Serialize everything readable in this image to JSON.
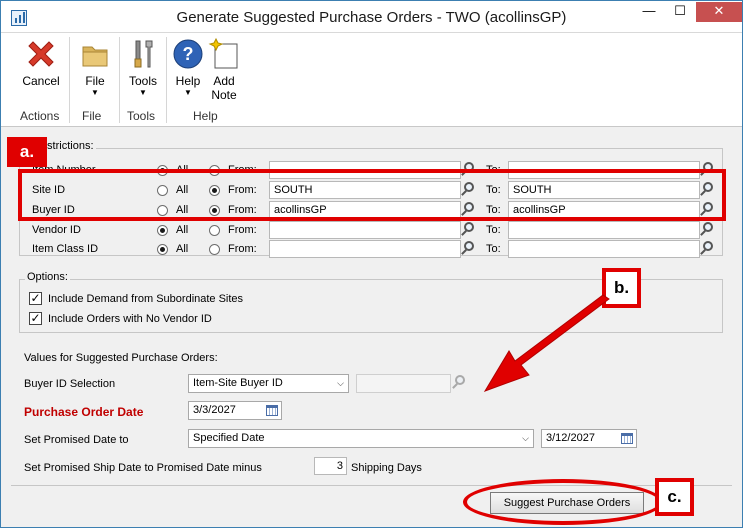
{
  "window": {
    "title": "Generate Suggested Purchase Orders  -  TWO (acollinsGP)",
    "controls": {
      "minimize": "—",
      "maximize": "☐",
      "close": "✕"
    }
  },
  "ribbon": {
    "buttons": [
      {
        "id": "cancel",
        "label": "Cancel",
        "icon": "cancel-x-icon"
      },
      {
        "id": "file",
        "label": "File",
        "icon": "folder-icon",
        "dropdown": true
      },
      {
        "id": "tools",
        "label": "Tools",
        "icon": "tools-icon",
        "dropdown": true
      },
      {
        "id": "help",
        "label": "Help",
        "icon": "help-question-icon",
        "dropdown": true
      },
      {
        "id": "add_note",
        "label": "Add\nNote",
        "icon": "add-note-icon"
      }
    ],
    "groups": [
      "Actions",
      "File",
      "Tools",
      "Help"
    ]
  },
  "restrictions": {
    "legend": "Restrictions:",
    "all_label": "All",
    "from_label": "From:",
    "to_label": "To:",
    "rows": [
      {
        "label": "Item Number",
        "mode": "all",
        "from": "",
        "to": ""
      },
      {
        "label": "Site ID",
        "mode": "from",
        "from": "SOUTH",
        "to": "SOUTH"
      },
      {
        "label": "Buyer ID",
        "mode": "from",
        "from": "acollinsGP",
        "to": "acollinsGP"
      },
      {
        "label": "Vendor ID",
        "mode": "all",
        "from": "",
        "to": ""
      },
      {
        "label": "Item Class ID",
        "mode": "all",
        "from": "",
        "to": ""
      }
    ]
  },
  "options": {
    "legend": "Options:",
    "include_demand": {
      "label": "Include Demand from Subordinate Sites",
      "checked": true
    },
    "include_no_vendor": {
      "label": "Include Orders with No Vendor ID",
      "checked": true
    }
  },
  "values": {
    "heading": "Values for Suggested Purchase Orders:",
    "buyer_id_selection_label": "Buyer ID Selection",
    "buyer_id_selection_value": "Item-Site Buyer ID",
    "po_date_label": "Purchase Order Date",
    "po_date_value": "3/3/2027",
    "promised_date_label": "Set Promised Date to",
    "promised_date_option": "Specified Date",
    "promised_date_value": "3/12/2027",
    "ship_date_label": "Set Promised Ship Date to Promised Date minus",
    "shipping_days_value": "3",
    "shipping_days_label": "Shipping Days"
  },
  "actions": {
    "suggest_button": "Suggest Purchase Orders"
  },
  "annotations": {
    "a": "a.",
    "b": "b.",
    "c": "c.",
    "highlight_color": "#e00000"
  }
}
